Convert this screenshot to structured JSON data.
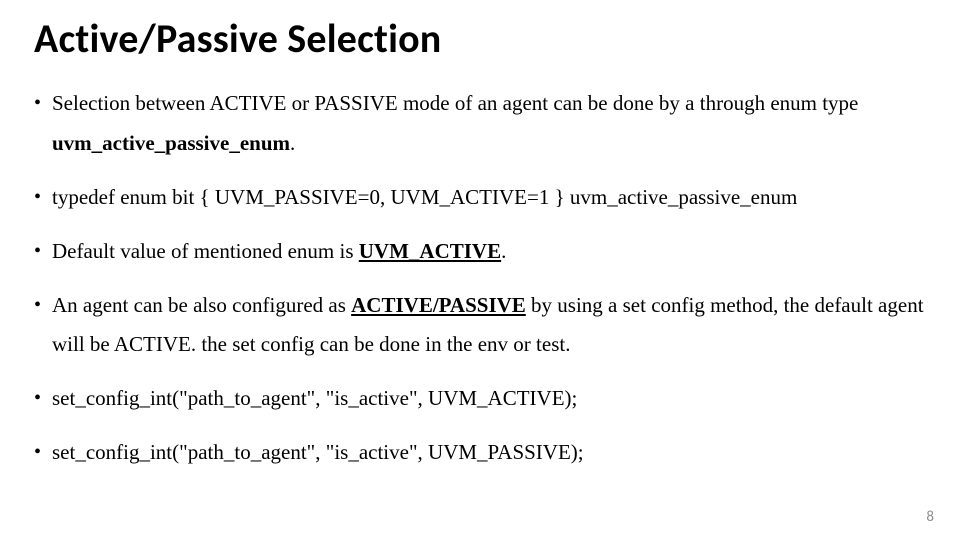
{
  "title": "Active/Passive Selection",
  "bullets": [
    {
      "pre": "Selection between ACTIVE or PASSIVE mode of an agent can be done by a through enum type ",
      "emph": "uvm_active_passive_enum",
      "emph_bold": true,
      "emph_underline": false,
      "post": "."
    },
    {
      "pre": "typedef enum bit { UVM_PASSIVE=0, UVM_ACTIVE=1 } uvm_active_passive_enum",
      "emph": "",
      "emph_bold": false,
      "emph_underline": false,
      "post": ""
    },
    {
      "pre": "Default value of mentioned enum is ",
      "emph": "UVM_ACTIVE",
      "emph_bold": true,
      "emph_underline": true,
      "post": "."
    },
    {
      "pre": "An agent can be also configured as ",
      "emph": "ACTIVE/PASSIVE",
      "emph_bold": true,
      "emph_underline": true,
      "post": " by using a set config method, the default agent will be ACTIVE. the set config can be done in the env or test."
    },
    {
      "pre": "set_config_int(\"path_to_agent\", \"is_active\", UVM_ACTIVE);",
      "emph": "",
      "emph_bold": false,
      "emph_underline": false,
      "post": ""
    },
    {
      "pre": "set_config_int(\"path_to_agent\", \"is_active\", UVM_PASSIVE);",
      "emph": "",
      "emph_bold": false,
      "emph_underline": false,
      "post": ""
    }
  ],
  "page_number": "8"
}
